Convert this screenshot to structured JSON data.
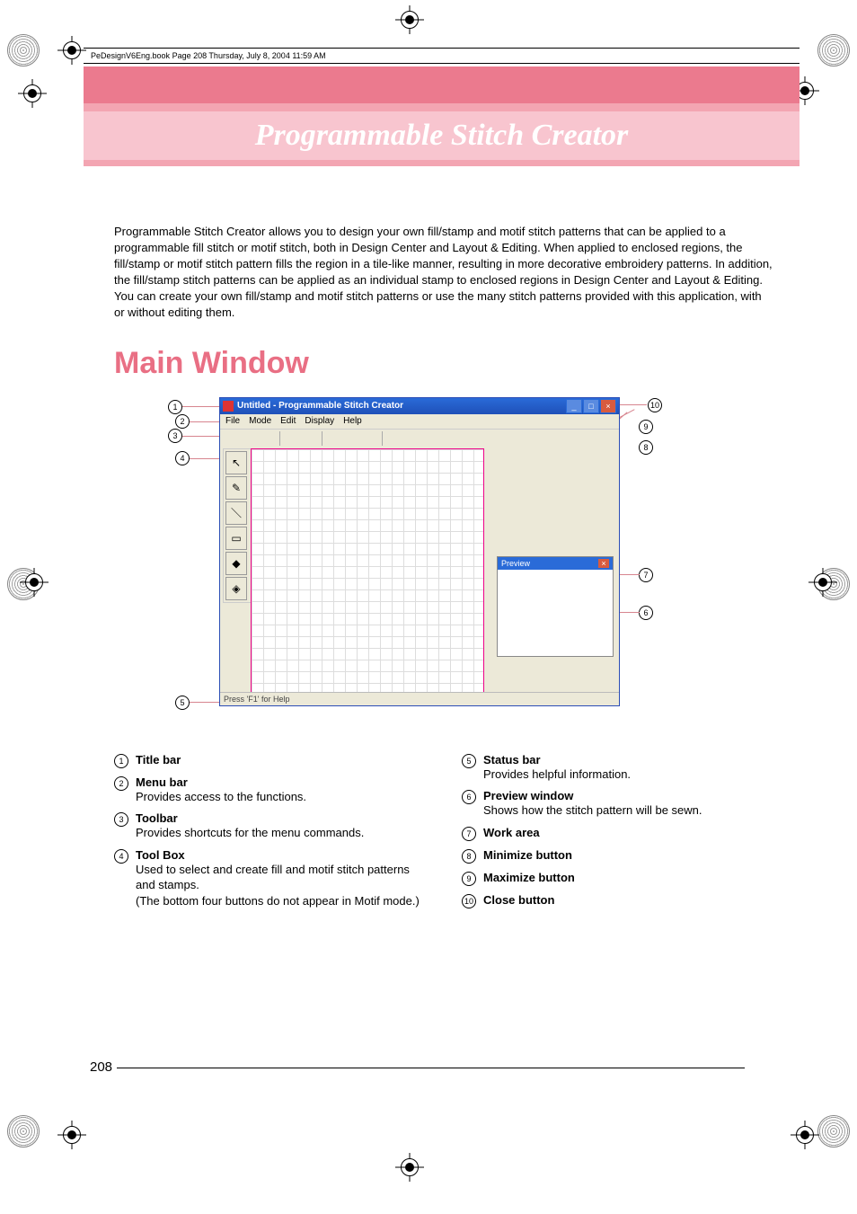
{
  "bookHeader": "PeDesignV6Eng.book  Page 208  Thursday, July 8, 2004  11:59 AM",
  "chapterTitle": "Programmable Stitch Creator",
  "intro": "Programmable Stitch Creator allows you to design your own fill/stamp and motif stitch patterns that can be applied to a programmable fill stitch or motif stitch, both in Design Center and Layout & Editing. When applied to enclosed regions, the fill/stamp or motif stitch pattern fills the region in a tile-like manner, resulting in more decorative embroidery patterns. In addition, the fill/stamp stitch patterns can be applied as an individual stamp to enclosed regions in Design Center and Layout & Editing. You can create your own fill/stamp and motif stitch patterns or use the many stitch patterns provided with this application, with or without editing them.",
  "h1": "Main Window",
  "window": {
    "title": "Untitled - Programmable Stitch Creator",
    "menus": [
      "File",
      "Mode",
      "Edit",
      "Display",
      "Help"
    ],
    "previewTitle": "Preview",
    "previewClose": "×",
    "status": "Press 'F1' for Help",
    "btnMin": "_",
    "btnMax": "□",
    "btnClose": "×"
  },
  "callouts": {
    "c1": "1",
    "c2": "2",
    "c3": "3",
    "c4": "4",
    "c5": "5",
    "c6": "6",
    "c7": "7",
    "c8": "8",
    "c9": "9",
    "c10": "10"
  },
  "legendLeft": [
    {
      "n": "1",
      "t": "Title bar",
      "d": ""
    },
    {
      "n": "2",
      "t": "Menu bar",
      "d": "Provides access to the functions."
    },
    {
      "n": "3",
      "t": "Toolbar",
      "d": "Provides shortcuts for the menu commands."
    },
    {
      "n": "4",
      "t": "Tool Box",
      "d": "Used to select and create fill and motif stitch patterns and stamps.\n(The bottom four buttons do not appear in Motif mode.)"
    }
  ],
  "legendRight": [
    {
      "n": "5",
      "t": "Status bar",
      "d": "Provides helpful information."
    },
    {
      "n": "6",
      "t": "Preview window",
      "d": "Shows how the stitch pattern will be sewn."
    },
    {
      "n": "7",
      "t": "Work area",
      "d": ""
    },
    {
      "n": "8",
      "t": "Minimize button",
      "d": ""
    },
    {
      "n": "9",
      "t": "Maximize button",
      "d": ""
    },
    {
      "n": "10",
      "t": "Close button",
      "d": ""
    }
  ],
  "pageNumber": "208"
}
